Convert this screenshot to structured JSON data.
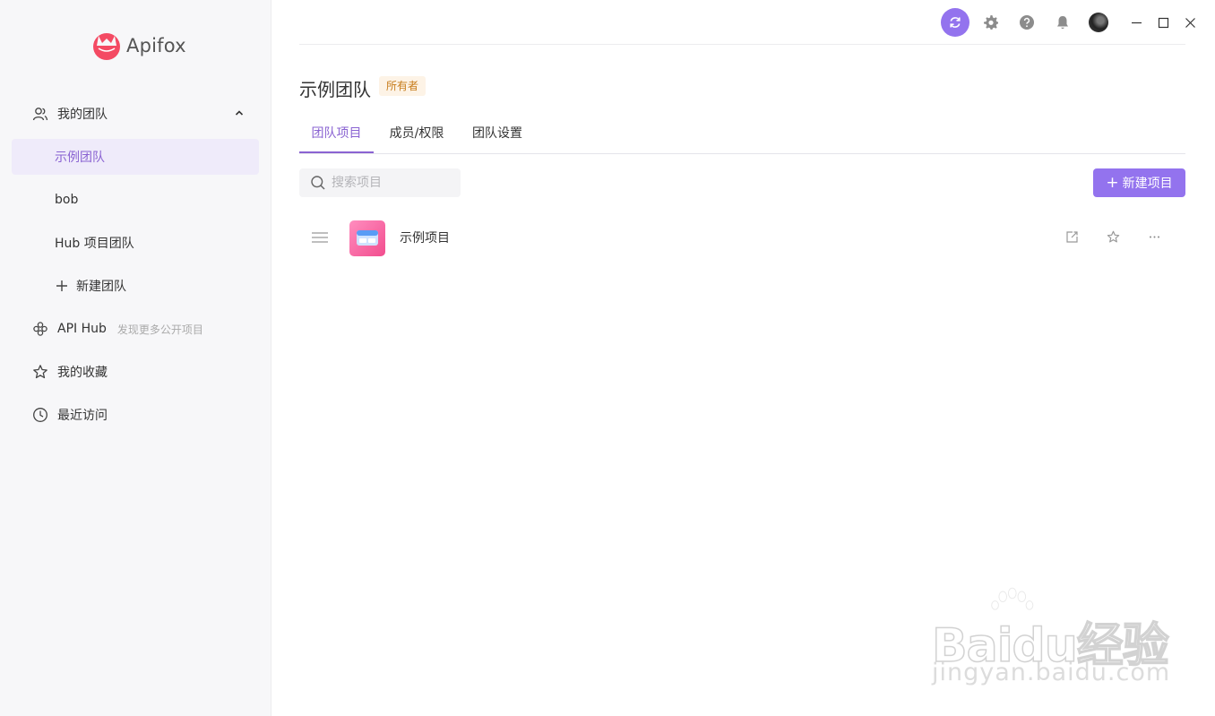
{
  "app": {
    "name": "Apifox"
  },
  "sidebar": {
    "my_teams": "我的团队",
    "teams": [
      {
        "label": "示例团队",
        "active": true
      },
      {
        "label": "bob",
        "active": false
      },
      {
        "label": "Hub 项目团队",
        "active": false
      }
    ],
    "new_team": "新建团队",
    "api_hub": "API Hub",
    "api_hub_hint": "发现更多公开项目",
    "favorites": "我的收藏",
    "recent": "最近访问"
  },
  "header": {
    "icons": [
      "sync-icon",
      "gear-icon",
      "help-icon",
      "bell-icon",
      "avatar",
      "minimize-icon",
      "maximize-icon",
      "close-icon"
    ]
  },
  "team": {
    "title": "示例团队",
    "role_badge": "所有者"
  },
  "tabs": [
    {
      "label": "团队项目",
      "active": true
    },
    {
      "label": "成员/权限",
      "active": false
    },
    {
      "label": "团队设置",
      "active": false
    }
  ],
  "search": {
    "placeholder": "搜索项目",
    "value": ""
  },
  "new_project_button": "新建项目",
  "projects": [
    {
      "name": "示例项目"
    }
  ],
  "watermark": {
    "brand": "Baidu经验",
    "url": "jingyan.baidu.com"
  },
  "colors": {
    "accent": "#9373ee",
    "active_text": "#8a63d2",
    "badge_bg": "#fdf3e6",
    "badge_text": "#c77c1b"
  }
}
